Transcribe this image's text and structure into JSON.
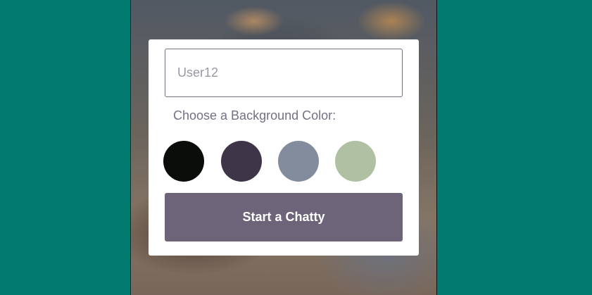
{
  "login": {
    "name_value": "User12",
    "color_prompt": "Choose a Background Color:",
    "colors": [
      "#0b0d0a",
      "#3e3548",
      "#838c9c",
      "#b0c0a2"
    ],
    "start_label": "Start a Chatty",
    "button_color": "#6d6479"
  },
  "page": {
    "background_color": "#037a70"
  }
}
